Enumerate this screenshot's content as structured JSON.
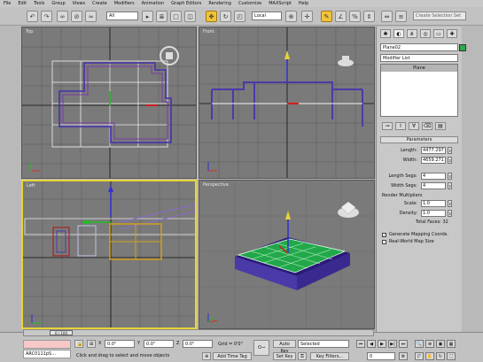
{
  "menu": [
    "File",
    "Edit",
    "Tools",
    "Group",
    "Views",
    "Create",
    "Modifiers",
    "Animation",
    "Graph Editors",
    "Rendering",
    "Customize",
    "MAXScript",
    "Help"
  ],
  "toolbar": {
    "selection_filter": "All",
    "ref_coord": "Local",
    "search_placeholder": "Create Selection Set"
  },
  "viewports": {
    "top": "Top",
    "front": "Front",
    "left": "Left",
    "perspective": "Perspective"
  },
  "command_panel": {
    "object_name": "Plane02",
    "object_color": "#2fa84a",
    "modifier_list": "Modifier List",
    "stack_item": "Plane",
    "rollout": "Parameters",
    "params": [
      {
        "label": "Length:",
        "value": "4477.297"
      },
      {
        "label": "Width:",
        "value": "4659.271"
      }
    ],
    "segs": [
      {
        "label": "Length Segs:",
        "value": "4"
      },
      {
        "label": "Width Segs:",
        "value": "4"
      }
    ],
    "render_multipliers": "Render Multipliers",
    "mults": [
      {
        "label": "Scale:",
        "value": "1.0"
      },
      {
        "label": "Density:",
        "value": "1.0"
      }
    ],
    "total_faces": "Total Faces: 32",
    "gen_mapping": "Generate Mapping Coords.",
    "real_world": "Real-World Map Size"
  },
  "timeline": {
    "frame": "0 / 100"
  },
  "status": {
    "maxscript_out": "ARC0111pS...",
    "x": "0.0\"",
    "y": "0.0\"",
    "z": "0.0\"",
    "grid": "Grid = 0'0\"",
    "prompt": "Click and drag to select and move objects",
    "add_time_tag": "Add Time Tag",
    "auto_key": "Auto Key",
    "set_key": "Set Key",
    "selected": "Selected",
    "key_filters": "Key Filters...",
    "frame_field": "0"
  }
}
